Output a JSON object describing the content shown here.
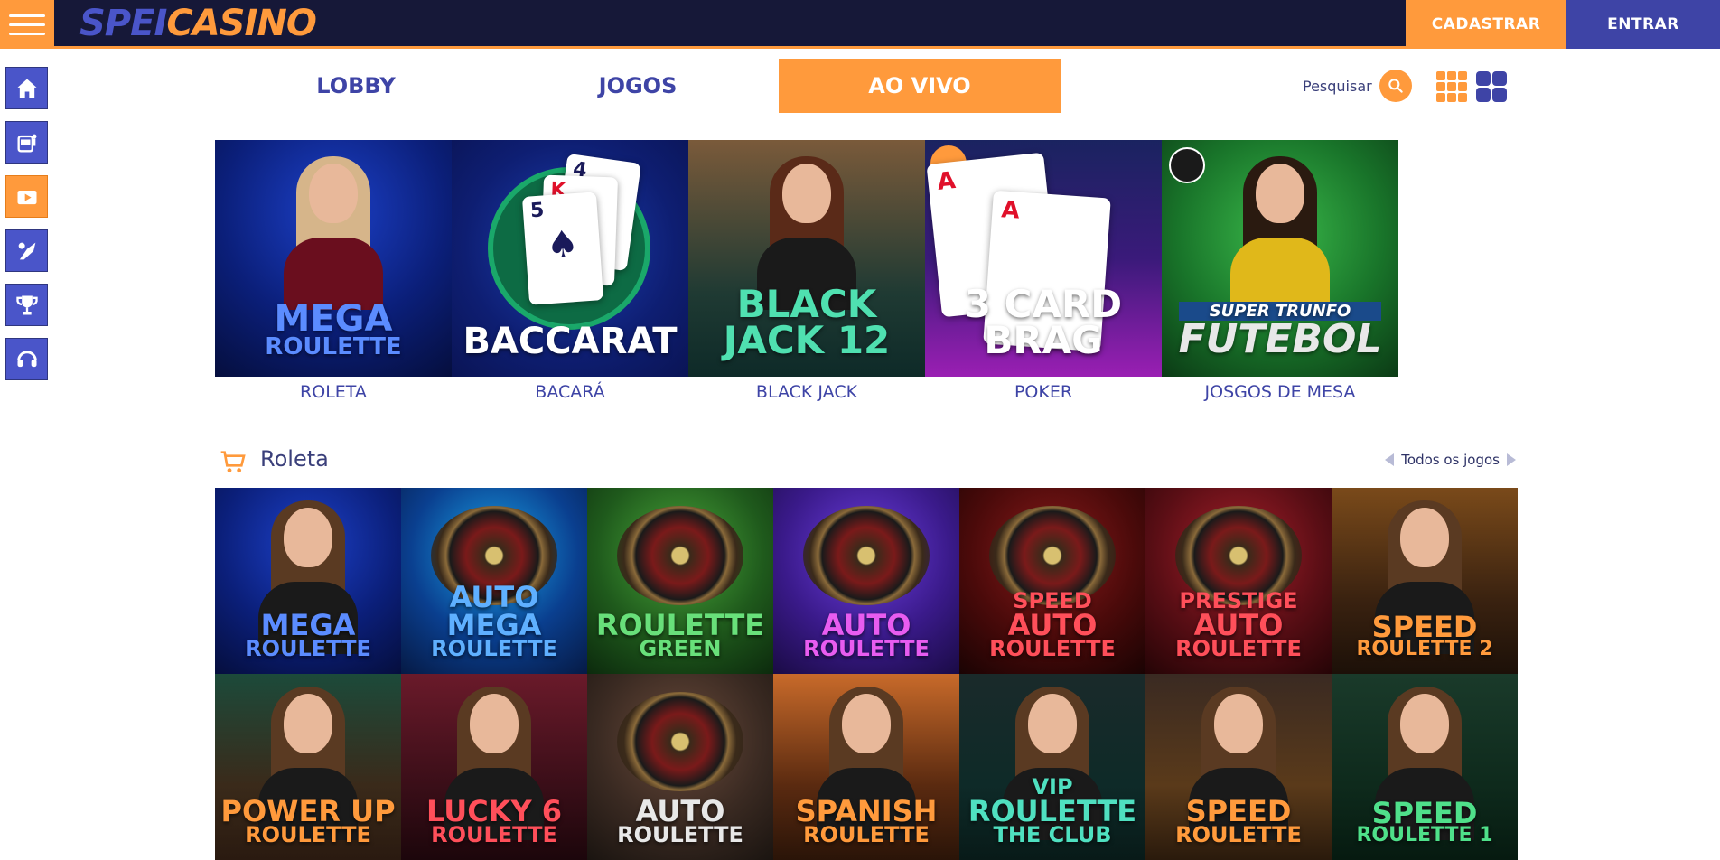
{
  "header": {
    "logo_part1": "SPEI",
    "logo_part2": "CASINO",
    "register_label": "CADASTRAR",
    "login_label": "ENTRAR"
  },
  "siderail": [
    {
      "icon": "home-icon"
    },
    {
      "icon": "slot-machine-icon"
    },
    {
      "icon": "live-video-icon"
    },
    {
      "icon": "sports-icon"
    },
    {
      "icon": "trophy-icon"
    },
    {
      "icon": "support-icon"
    }
  ],
  "nav": {
    "tabs": [
      {
        "label": "LOBBY"
      },
      {
        "label": "JOGOS"
      },
      {
        "label": "AO VIVO",
        "active": true
      }
    ],
    "search_label": "Pesquisar"
  },
  "categories": [
    {
      "label": "ROLETA",
      "tile_title_1": "MEGA",
      "tile_title_2": "ROULETTE"
    },
    {
      "label": "BACARÁ",
      "tile_title_1": "BACCARAT",
      "tile_title_2": ""
    },
    {
      "label": "BLACK JACK",
      "tile_title_1": "BLACK",
      "tile_title_2": "JACK 12"
    },
    {
      "label": "POKER",
      "tile_title_1": "3 CARD",
      "tile_title_2": "BRAG"
    },
    {
      "label": "JOSGOS DE MESA",
      "tile_title_1": "SUPER TRUNFO",
      "tile_title_2": "FUTEBOL"
    }
  ],
  "section": {
    "title": "Roleta",
    "all_games_label": "Todos os jogos"
  },
  "games": [
    {
      "t1": "MEGA",
      "t2": "ROULETTE",
      "c1": "#5b8cff",
      "c2": "#5b8cff",
      "bg": "radial-gradient(circle at 50% 30%, #1c40c8 0%, #0b1f7a 55%, #050e3d 100%)",
      "kind": "person"
    },
    {
      "t1": "AUTO MEGA",
      "t2": "ROULETTE",
      "c1": "#5fb0ff",
      "c2": "#5fb0ff",
      "bg": "radial-gradient(circle at 50% 35%, #1aa6e8 0%, #0a3f8f 55%, #061a45 100%)",
      "kind": "wheel"
    },
    {
      "t1": "ROULETTE",
      "t2": "GREEN",
      "c1": "#68e07a",
      "c2": "#68e07a",
      "bg": "radial-gradient(circle at 50% 35%, #4aa83a 0%, #1f5a1c 55%, #0c2a0d 100%)",
      "kind": "wheel"
    },
    {
      "t1": "AUTO",
      "t2": "ROULETTE",
      "c1": "#e85cf0",
      "c2": "#e85cf0",
      "bg": "radial-gradient(circle at 50% 35%, #6c3ee0 0%, #3a1a8a 55%, #1a0b45 100%)",
      "kind": "wheel"
    },
    {
      "t1": "SPEED",
      "t2": "AUTO",
      "t3": "ROULETTE",
      "c1": "#ff4f5a",
      "c2": "#ff4f5a",
      "bg": "radial-gradient(circle at 50% 35%, #8a1a1a 0%, #4a0a0a 55%, #1a0303 100%)",
      "kind": "wheel"
    },
    {
      "t1": "PRESTIGE",
      "t2": "AUTO",
      "t3": "ROULETTE",
      "c1": "#ff4f5a",
      "c2": "#ff4f5a",
      "bg": "radial-gradient(circle at 50% 35%, #a81f2a 0%, #5a0e15 55%, #250406 100%)",
      "kind": "wheel"
    },
    {
      "t1": "SPEED",
      "t2": "ROULETTE 2",
      "c1": "#ff9a3c",
      "c2": "#ff9a3c",
      "bg": "linear-gradient(180deg, #7a4a1a 0%, #3a2210 60%, #1c1008 100%)",
      "kind": "person"
    },
    {
      "t1": "POWER UP",
      "t2": "ROULETTE",
      "c1": "#ff9a3c",
      "c2": "#ff9a3c",
      "bg": "linear-gradient(180deg, #1c4a3a 0%, #3a2a1a 60%, #2a1a10 100%)",
      "kind": "person"
    },
    {
      "t1": "LUCKY 6",
      "t2": "ROULETTE",
      "c1": "#ff4f5a",
      "c2": "#ff4f5a",
      "bg": "linear-gradient(180deg, #6a1a2a 0%, #3a0e18 60%, #1c060b 100%)",
      "kind": "person"
    },
    {
      "t1": "AUTO",
      "t2": "ROULETTE",
      "c1": "#e8e8e8",
      "c2": "#e8e8e8",
      "bg": "radial-gradient(circle at 50% 35%, #6a4a3a 0%, #3a2a22 55%, #1a1410 100%)",
      "kind": "wheel"
    },
    {
      "t1": "SPANISH",
      "t2": "ROULETTE",
      "c1": "#ff9a3c",
      "c2": "#ff9a3c",
      "bg": "linear-gradient(180deg, #c86a2a 0%, #5a2a10 60%, #2a1408 100%)",
      "kind": "person"
    },
    {
      "t1": "VIP",
      "t2": "ROULETTE",
      "t3": "THE CLUB",
      "c1": "#4fe0c0",
      "c2": "#4fe0c0",
      "bg": "linear-gradient(180deg, #1a2a2a 0%, #0e2a28 60%, #081a18 100%)",
      "kind": "person"
    },
    {
      "t1": "SPEED",
      "t2": "ROULETTE",
      "c1": "#ff9a3c",
      "c2": "#ff9a3c",
      "bg": "linear-gradient(180deg, #3a2a22 0%, #5a3a1a 60%, #2a1a0c 100%)",
      "kind": "person"
    },
    {
      "t1": "SPEED",
      "t2": "ROULETTE 1",
      "c1": "#4fe08a",
      "c2": "#4fe08a",
      "bg": "linear-gradient(180deg, #1a3a2a 0%, #0e2a1c 60%, #061a10 100%)",
      "kind": "person"
    }
  ],
  "colors": {
    "accent": "#ff9a3c",
    "brand": "#3e44a6",
    "topbar": "#161838"
  }
}
